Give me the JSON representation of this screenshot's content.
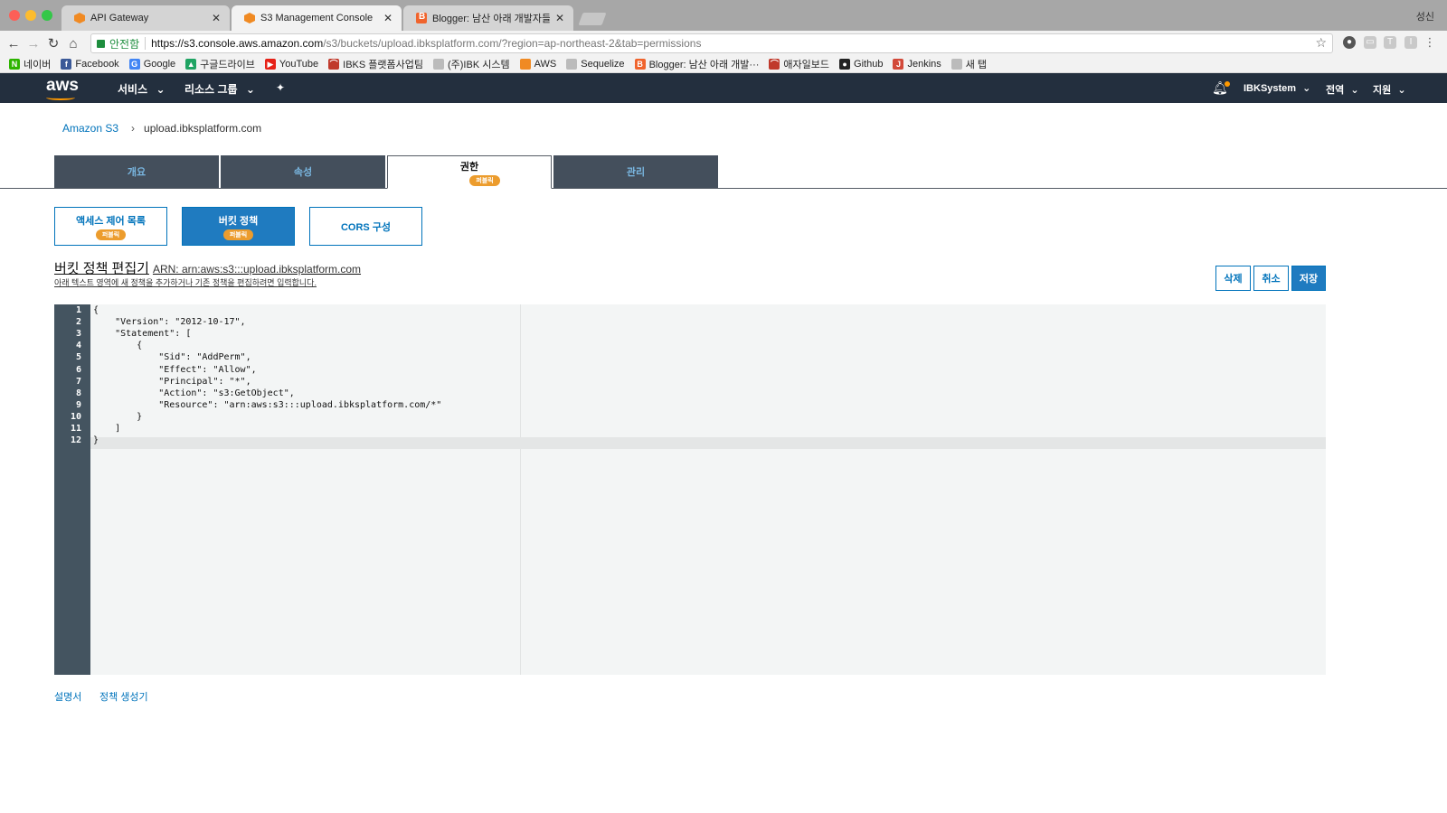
{
  "browser": {
    "tabs": [
      {
        "title": "API Gateway",
        "close": "✕"
      },
      {
        "title": "S3 Management Console",
        "close": "✕"
      },
      {
        "title": "Blogger: 남산 아래 개발자들 - 게시",
        "close": "✕"
      }
    ],
    "profile": "성신",
    "secure_label": "안전함",
    "url_host": "https://s3.console.aws.amazon.com",
    "url_path": "/s3/buckets/upload.ibksplatform.com/?region=ap-northeast-2&tab=permissions",
    "bookmarks": [
      {
        "label": "네이버",
        "icon": "naver-icon",
        "color": "#2db400",
        "glyph": "N"
      },
      {
        "label": "Facebook",
        "icon": "facebook-icon",
        "color": "#3b5998",
        "glyph": "f"
      },
      {
        "label": "Google",
        "icon": "google-icon",
        "color": "#4285f4",
        "glyph": "G"
      },
      {
        "label": "구글드라이브",
        "icon": "google-drive-icon",
        "color": "#1fa463",
        "glyph": "▲"
      },
      {
        "label": "YouTube",
        "icon": "youtube-icon",
        "color": "#e62117",
        "glyph": "▶"
      },
      {
        "label": "IBKS 플랫폼사업팀",
        "icon": "ibks-icon",
        "color": "#c0392b",
        "glyph": "⌒"
      },
      {
        "label": "(주)IBK 시스템",
        "icon": "page-icon",
        "color": "#bbbbbb",
        "glyph": ""
      },
      {
        "label": "AWS",
        "icon": "aws-icon",
        "color": "#f08a23",
        "glyph": ""
      },
      {
        "label": "Sequelize",
        "icon": "page-icon",
        "color": "#bbbbbb",
        "glyph": ""
      },
      {
        "label": "Blogger: 남산 아래 개발···",
        "icon": "blogger-icon",
        "color": "#f0642d",
        "glyph": "B"
      },
      {
        "label": "애자일보드",
        "icon": "agile-icon",
        "color": "#c0392b",
        "glyph": "⌒"
      },
      {
        "label": "Github",
        "icon": "github-icon",
        "color": "#222222",
        "glyph": "●"
      },
      {
        "label": "Jenkins",
        "icon": "jenkins-icon",
        "color": "#d24939",
        "glyph": "J"
      },
      {
        "label": "새 탭",
        "icon": "page-icon",
        "color": "#bbbbbb",
        "glyph": ""
      }
    ]
  },
  "awsnav": {
    "logo": "aws",
    "services": "서비스",
    "resource_groups": "리소스 그룹",
    "account": "IBKSystem",
    "region": "전역",
    "support": "지원",
    "caret": "⌄"
  },
  "breadcrumb": {
    "root": "Amazon S3",
    "sep": "›",
    "current": "upload.ibksplatform.com"
  },
  "main_tabs": [
    {
      "label": "개요"
    },
    {
      "label": "속성"
    },
    {
      "label": "권한",
      "badge": "퍼블릭"
    },
    {
      "label": "관리"
    }
  ],
  "sub_tabs": [
    {
      "label": "액세스 제어 목록",
      "badge": "퍼블릭"
    },
    {
      "label": "버킷 정책",
      "badge": "퍼블릭"
    },
    {
      "label": "CORS 구성"
    }
  ],
  "editor": {
    "title": "버킷 정책 편집기",
    "arn": "ARN: arn:aws:s3:::upload.ibksplatform.com",
    "description": "아래 텍스트 영역에 새 정책을 추가하거나 기존 정책을 편집하려면 입력합니다.",
    "delete_label": "삭제",
    "cancel_label": "취소",
    "save_label": "저장",
    "lines": [
      "{",
      "    \"Version\": \"2012-10-17\",",
      "    \"Statement\": [",
      "        {",
      "            \"Sid\": \"AddPerm\",",
      "            \"Effect\": \"Allow\",",
      "            \"Principal\": \"*\",",
      "            \"Action\": \"s3:GetObject\",",
      "            \"Resource\": \"arn:aws:s3:::upload.ibksplatform.com/*\"",
      "        }",
      "    ]",
      "}"
    ]
  },
  "footer": {
    "docs": "설명서",
    "policy_generator": "정책 생성기"
  },
  "colors": {
    "aws_nav": "#232f3e",
    "accent_blue": "#0073bb",
    "primary_button": "#1f7bc0",
    "badge_orange": "#ec9c2d",
    "tab_dark": "#444f5c",
    "gutter": "#445460"
  }
}
